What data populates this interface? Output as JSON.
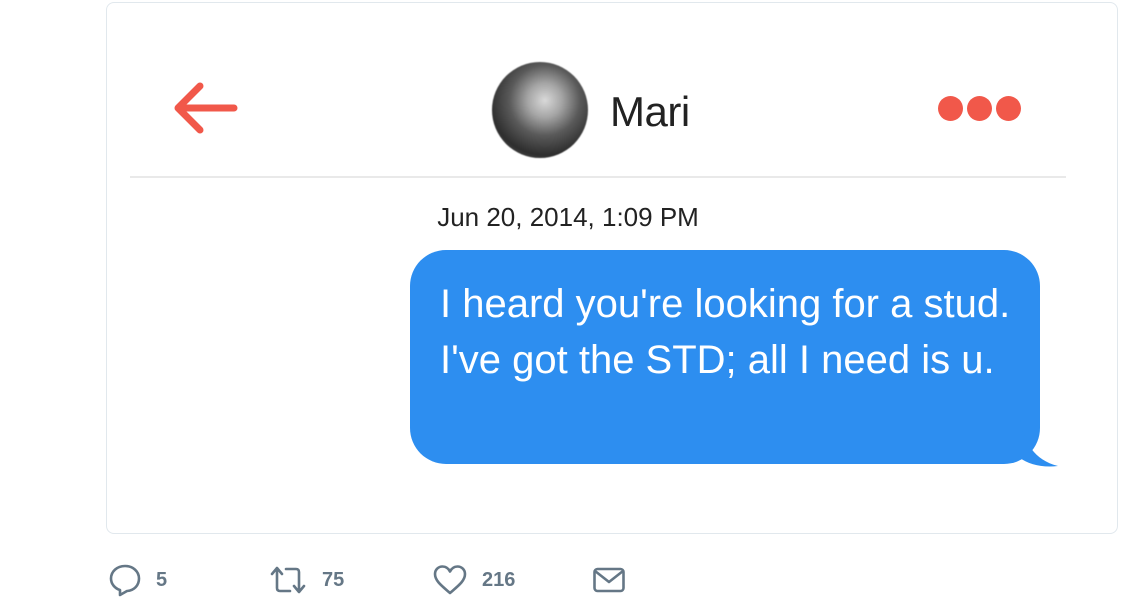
{
  "conversation": {
    "contact_name": "Mari",
    "timestamp": "Jun 20, 2014, 1:09 PM",
    "message": "I heard you're looking for a stud. I've got the STD; all I need is u."
  },
  "icons": {
    "back": "back-arrow-icon",
    "more": "more-dots-icon",
    "reply": "reply-icon",
    "retweet": "retweet-icon",
    "like": "heart-icon",
    "dm": "envelope-icon"
  },
  "colors": {
    "accent": "#f1584a",
    "bubble": "#2d8ef0",
    "action_gray": "#657786"
  },
  "tweet_actions": {
    "reply_count": "5",
    "retweet_count": "75",
    "like_count": "216"
  }
}
